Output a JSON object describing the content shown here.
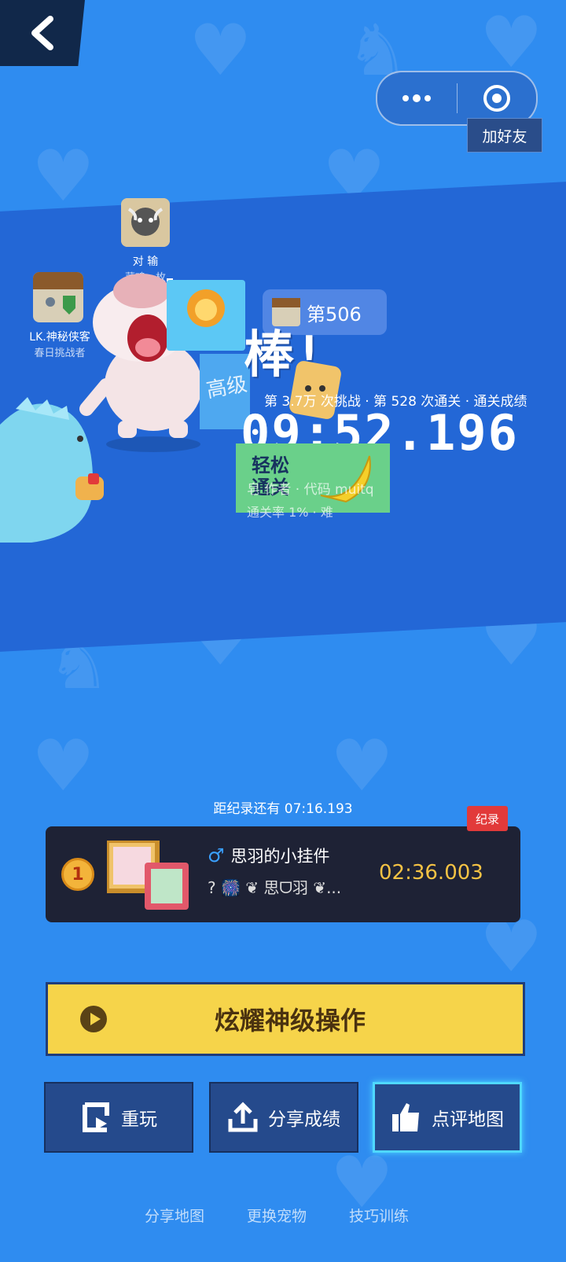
{
  "header": {
    "add_friend": "加好友"
  },
  "players": [
    {
      "name": "对 输",
      "subtitle": "菜鸡一枚"
    },
    {
      "name": "LK.神秘侠客",
      "subtitle": "春日挑战者"
    }
  ],
  "result": {
    "rank_label": "第506",
    "praise": "棒!",
    "stats_line": "第 3.7万 次挑战 · 第 528 次通关 · 通关成绩",
    "time": "09:52.196",
    "difficulty_tag": "高级",
    "easy_tag": "轻松通关",
    "author_line": "皂 作者 · 代码 muitq",
    "pass_rate": "通关率 1% · 难"
  },
  "record": {
    "gap_text": "距纪录还有 07:16.193",
    "badge": "纪录",
    "rank": "1",
    "holder_name": "思羽的小挂件",
    "gender_icon": "♂",
    "second_line": "? 🎆 ❦ 思ᗜ羽 ❦...",
    "time": "02:36.003"
  },
  "buttons": {
    "main": "炫耀神级操作",
    "replay": "重玩",
    "share": "分享成绩",
    "review": "点评地图"
  },
  "bottom_links": [
    "分享地图",
    "更换宠物",
    "技巧训练"
  ],
  "colors": {
    "background": "#2f8cf0",
    "accent_yellow": "#f6d44a",
    "panel": "#1e2235",
    "record_time": "#f6c344",
    "badge_red": "#e23a3a"
  }
}
